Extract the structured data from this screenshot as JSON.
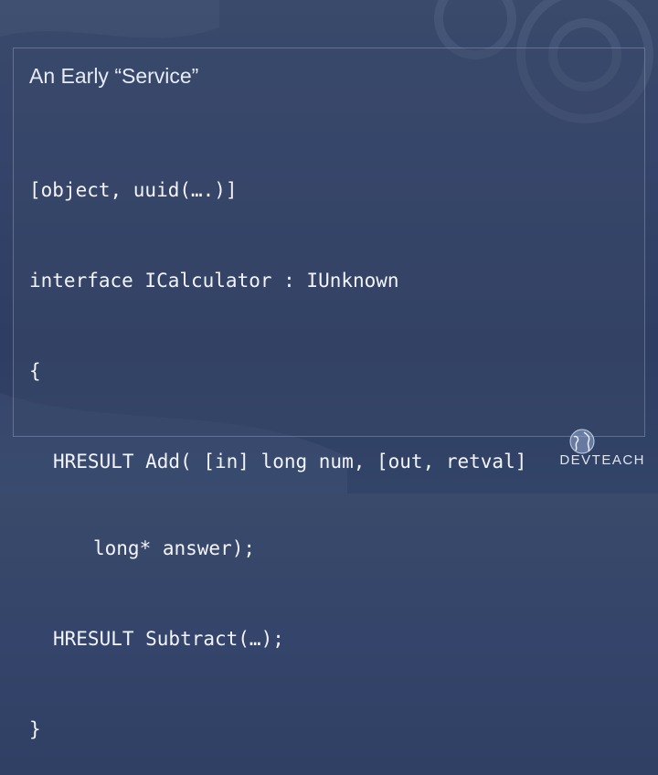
{
  "slide": {
    "title": "An Early “Service”",
    "code_lines": [
      "[object, uuid(….)]",
      "interface ICalculator : IUnknown",
      "{",
      "HRESULT Add( [in] long num, [out, retval]",
      "long* answer);",
      "HRESULT Subtract(…);",
      "}"
    ]
  },
  "branding": {
    "logo_text": "DEVTEACH",
    "logo_icon": "globe-icon"
  },
  "colors": {
    "background": "#34446a",
    "text": "#f2f4fa",
    "title": "#e6ebf5"
  }
}
